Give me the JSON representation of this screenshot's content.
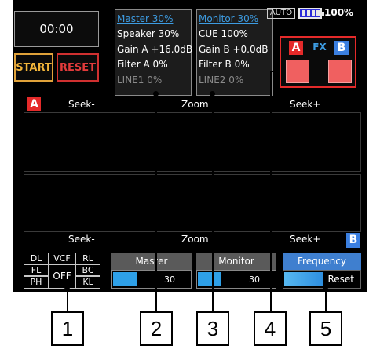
{
  "timer": {
    "display": "00:00"
  },
  "controls": {
    "start_label": "START",
    "reset_label": "RESET"
  },
  "master_panel": {
    "title": "Master 30%",
    "lines": [
      "Speaker 30%",
      "Gain A +16.0dB",
      "Filter A 0%"
    ],
    "input": "LINE1 0%"
  },
  "monitor_panel": {
    "title": "Monitor 30%",
    "lines": [
      "CUE 100%",
      "Gain B +0.0dB",
      "Filter B 0%"
    ],
    "input": "LINE2 0%"
  },
  "status": {
    "auto_label": "AUTO",
    "battery_percent": "100%"
  },
  "fx": {
    "a_label": "A",
    "fx_label": "FX",
    "b_label": "B"
  },
  "deck_a": {
    "tag": "A",
    "seek_minus": "Seek-",
    "zoom": "Zoom",
    "seek_plus": "Seek+"
  },
  "deck_b": {
    "tag": "B",
    "seek_minus": "Seek-",
    "zoom": "Zoom",
    "seek_plus": "Seek+"
  },
  "effects": {
    "row1": [
      "DL",
      "VCF",
      "RL"
    ],
    "left2": "FL",
    "left3": "PH",
    "center": "OFF",
    "right2": "BC",
    "right3": "KL",
    "selected": "VCF"
  },
  "faders": {
    "master": {
      "label": "Master",
      "value": "30",
      "level": 0.3
    },
    "monitor": {
      "label": "Monitor",
      "value": "30",
      "level": 0.3
    },
    "frequency": {
      "label": "Frequency",
      "reset_label": "Reset",
      "level": 0.5
    }
  },
  "callouts": [
    "1",
    "2",
    "3",
    "4",
    "5"
  ],
  "colors": {
    "accent_blue": "#3d9ce2",
    "deck_a_red": "#e52a2a",
    "deck_b_blue": "#3b7fe0",
    "start_orange": "#f2b53a"
  }
}
